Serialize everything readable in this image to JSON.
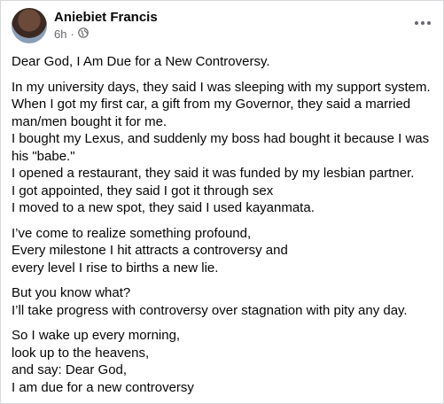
{
  "post": {
    "author": "Aniebiet Francis",
    "time": "6h",
    "separator": "·",
    "audience_icon": "globe-icon",
    "more_icon": "more-options-icon",
    "paragraphs": [
      [
        "Dear God, I Am Due for a New Controversy."
      ],
      [
        "In my university days, they said I was sleeping with my support system.",
        "When I got my first car, a gift from my Governor, they said a married",
        "man/men bought it for me.",
        "I bought my Lexus, and suddenly my boss had bought it because I was",
        "his \"babe.\"",
        "I opened a restaurant, they said it was funded by my lesbian partner.",
        "I got appointed, they said I got it through sex",
        "I moved to a new spot, they said I used kayanmata."
      ],
      [
        "I’ve come to realize something profound,",
        "Every milestone I hit attracts a controversy and",
        "every level I rise to births a new lie."
      ],
      [
        "But you know what?",
        "I’ll take progress with controversy over stagnation with pity any day."
      ],
      [
        "So I wake up every morning,",
        "look up to the heavens,",
        "and say: Dear God,",
        "I am due for a new controversy"
      ]
    ]
  },
  "colors": {
    "text": "#050505",
    "secondary": "#65676b",
    "border": "#d6d8dc"
  }
}
